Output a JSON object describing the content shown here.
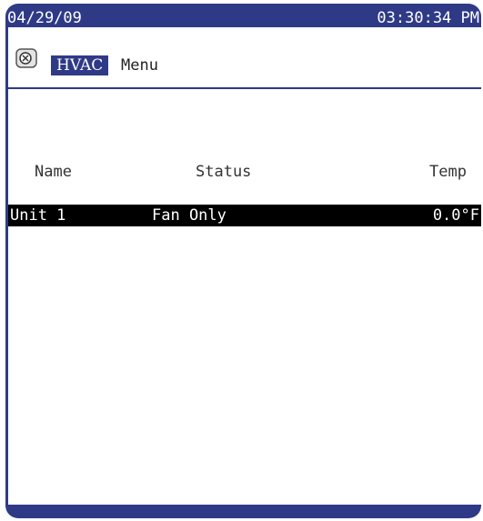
{
  "header": {
    "date": "04/29/09",
    "time": "03:30:34 PM"
  },
  "menu": {
    "icon": "hvac-unit-icon",
    "highlight_label": "HVAC",
    "label": "Menu"
  },
  "table": {
    "columns": [
      "Name",
      "Status",
      "Temp"
    ],
    "rows": [
      {
        "name": "Unit 1",
        "status": "Fan Only",
        "temp": "0.0°F"
      }
    ]
  },
  "colors": {
    "frame": "#2f3a87",
    "screen": "#ffffff",
    "selected_row": "#000000"
  }
}
